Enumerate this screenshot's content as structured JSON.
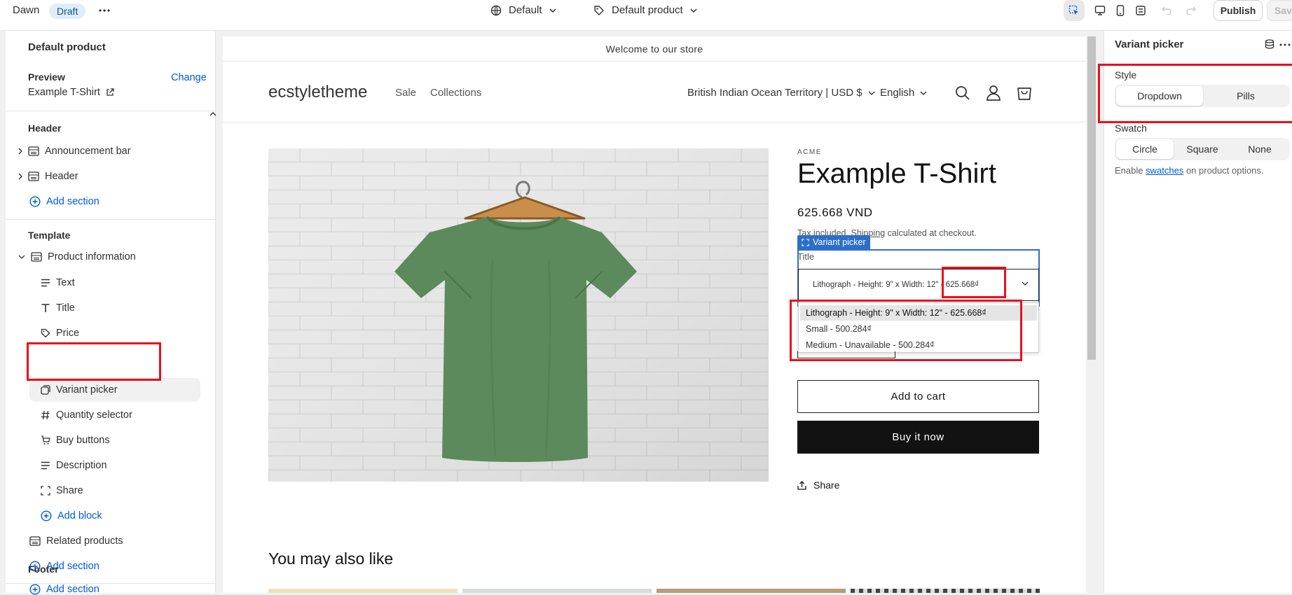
{
  "topbar": {
    "theme_name": "Dawn",
    "status_badge": "Draft",
    "more": "···",
    "context_default": "Default",
    "template_default": "Default product",
    "publish": "Publish",
    "save": "Save"
  },
  "leftbar": {
    "page_title": "Default product",
    "preview_label": "Preview",
    "preview_change": "Change",
    "preview_product": "Example T-Shirt",
    "header_section": "Header",
    "announcement_bar": "Announcement bar",
    "header_item": "Header",
    "add_section_1": "Add section",
    "template_section": "Template",
    "product_information": "Product information",
    "blocks": [
      "Text",
      "Title",
      "Price",
      "Variant picker",
      "Quantity selector",
      "Buy buttons",
      "Description",
      "Share"
    ],
    "add_block": "Add block",
    "related_products": "Related products",
    "add_section_2": "Add section",
    "footer_section": "Footer",
    "add_section_3": "Add section"
  },
  "preview": {
    "announcement": "Welcome to our store",
    "store_name": "ecstyletheme",
    "nav": [
      "Sale",
      "Collections"
    ],
    "country": "British Indian Ocean Territory | USD $",
    "language": "English",
    "vendor": "ACME",
    "product_title": "Example T-Shirt",
    "price": "625.668 VND",
    "tax_prefix": "Tax included.",
    "tax_link": "Shipping",
    "tax_suffix": "calculated at checkout.",
    "variant_picker_label": "Variant picker",
    "option_title": "Title",
    "selected_value": "Lithograph - Height: 9\" x Width: 12\" - 625.668₫",
    "options": [
      "Lithograph - Height: 9\" x Width: 12\" - 625.668₫",
      "Small - 500.284₫",
      "Medium - Unavailable - 500.284₫"
    ],
    "add_to_cart": "Add to cart",
    "buy_now": "Buy it now",
    "share": "Share",
    "you_may_also_like": "You may also like"
  },
  "rightbar": {
    "title": "Variant picker",
    "style_label": "Style",
    "style_options": [
      "Dropdown",
      "Pills"
    ],
    "style_selected": "Dropdown",
    "swatch_label": "Swatch",
    "swatch_options": [
      "Circle",
      "Square",
      "None"
    ],
    "swatch_selected": "Circle",
    "help_prefix": "Enable",
    "help_link": "swatches",
    "help_suffix": "on product options."
  },
  "colors": {
    "accent": "#005bd3",
    "highlight": "#e8101c",
    "tshirt": "#5c8a5c"
  }
}
